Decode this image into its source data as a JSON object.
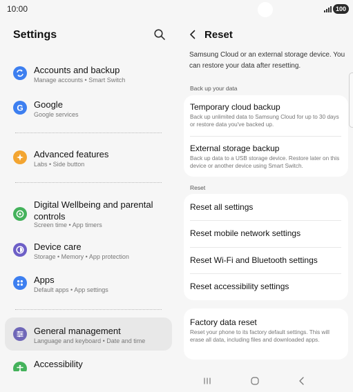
{
  "status_bar": {
    "time": "10:00",
    "battery": "100"
  },
  "left_pane": {
    "title": "Settings",
    "items": [
      {
        "title": "Accounts and backup",
        "subtitle": "Manage accounts  •  Smart Switch",
        "icon": "sync-icon",
        "color": "#3d7ff0"
      },
      {
        "title": "Google",
        "subtitle": "Google services",
        "icon": "google-icon",
        "color": "#3d7ff0"
      },
      {
        "title": "Advanced features",
        "subtitle": "Labs  •  Side button",
        "icon": "star-icon",
        "color": "#f3a531"
      },
      {
        "title": "Digital Wellbeing and parental controls",
        "subtitle": "Screen time  •  App timers",
        "icon": "wellbeing-icon",
        "color": "#44b25b"
      },
      {
        "title": "Device care",
        "subtitle": "Storage  •  Memory  •  App protection",
        "icon": "device-care-icon",
        "color": "#6d5fc7"
      },
      {
        "title": "Apps",
        "subtitle": "Default apps  •  App settings",
        "icon": "apps-icon",
        "color": "#3d7ff0"
      },
      {
        "title": "General management",
        "subtitle": "Language and keyboard  •  Date and time",
        "icon": "sliders-icon",
        "color": "#6f67b8"
      },
      {
        "title": "Accessibility",
        "subtitle": "",
        "icon": "accessibility-icon",
        "color": "#44b25b"
      }
    ]
  },
  "right_pane": {
    "title": "Reset",
    "intro": "Samsung Cloud or an external storage device. You can restore your data after resetting.",
    "backup_section_label": "Back up your data",
    "backup_rows": [
      {
        "title": "Temporary cloud backup",
        "description": "Back up unlimited data to Samsung Cloud for up to 30 days or restore data you've backed up."
      },
      {
        "title": "External storage backup",
        "description": "Back up data to a USB storage device. Restore later on this device or another device using Smart Switch."
      }
    ],
    "reset_section_label": "Reset",
    "reset_rows": [
      {
        "title": "Reset all settings"
      },
      {
        "title": "Reset mobile network settings"
      },
      {
        "title": "Reset Wi-Fi and Bluetooth settings"
      },
      {
        "title": "Reset accessibility settings"
      }
    ],
    "factory": {
      "title": "Factory data reset",
      "description": "Reset your phone to its factory default settings. This will erase all data, including files and downloaded apps."
    }
  }
}
